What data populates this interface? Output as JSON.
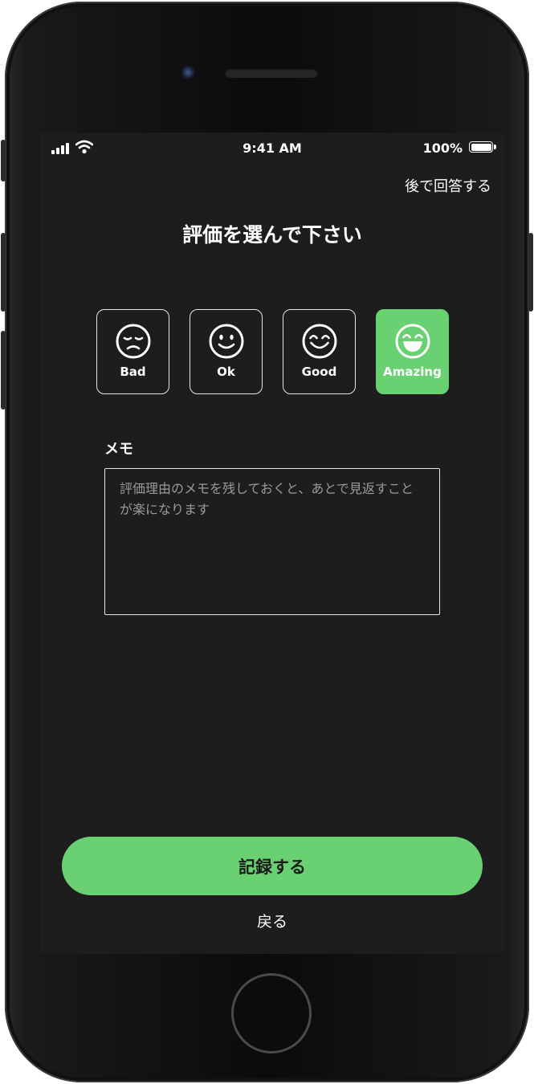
{
  "status_bar": {
    "time": "9:41 AM",
    "battery": "100%"
  },
  "header": {
    "later_link": "後で回答する",
    "title": "評価を選んで下さい"
  },
  "ratings": [
    {
      "label": "Bad",
      "icon": "sad-face-icon",
      "selected": false
    },
    {
      "label": "Ok",
      "icon": "neutral-smile-icon",
      "selected": false
    },
    {
      "label": "Good",
      "icon": "happy-face-icon",
      "selected": false
    },
    {
      "label": "Amazing",
      "icon": "grin-face-icon",
      "selected": true
    }
  ],
  "memo": {
    "label": "メモ",
    "placeholder": "評価理由のメモを残しておくと、あとで見返すことが楽になります",
    "value": ""
  },
  "actions": {
    "record_label": "記録する",
    "back_label": "戻る"
  },
  "colors": {
    "accent": "#6ad172",
    "background": "#1d1d1d",
    "text": "#ffffff"
  }
}
